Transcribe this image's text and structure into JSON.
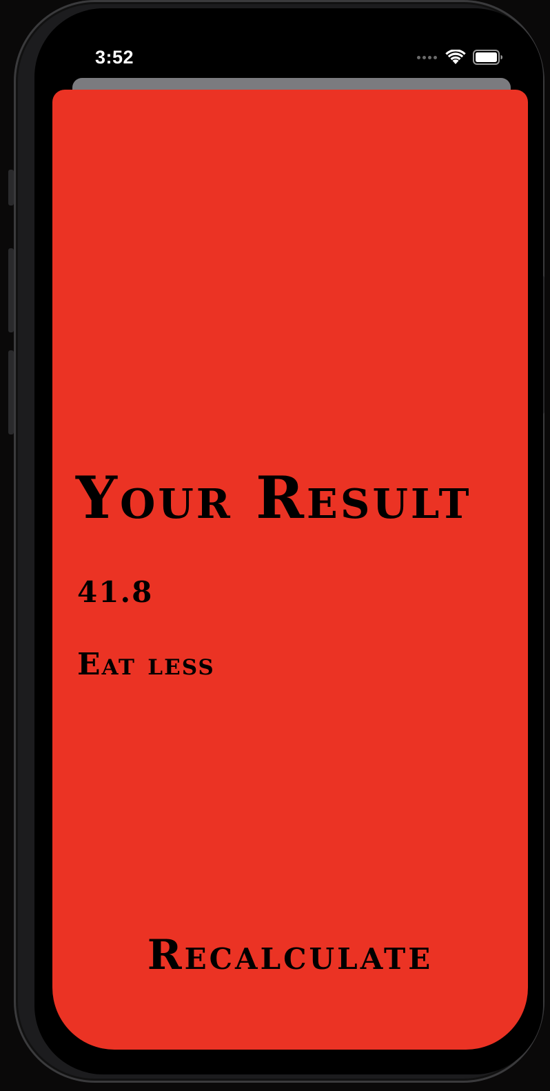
{
  "status_bar": {
    "time": "3:52",
    "wifi_icon": "wifi-icon",
    "battery_icon": "battery-icon",
    "signal_icon": "cellular-signal-icon"
  },
  "colors": {
    "sheet_background": "#eb3324",
    "text": "#000000",
    "home_indicator": "#b0302a"
  },
  "result": {
    "title": "Your Result",
    "value": "41.8",
    "advice": "Eat less"
  },
  "actions": {
    "recalculate_label": "Recalculate"
  }
}
